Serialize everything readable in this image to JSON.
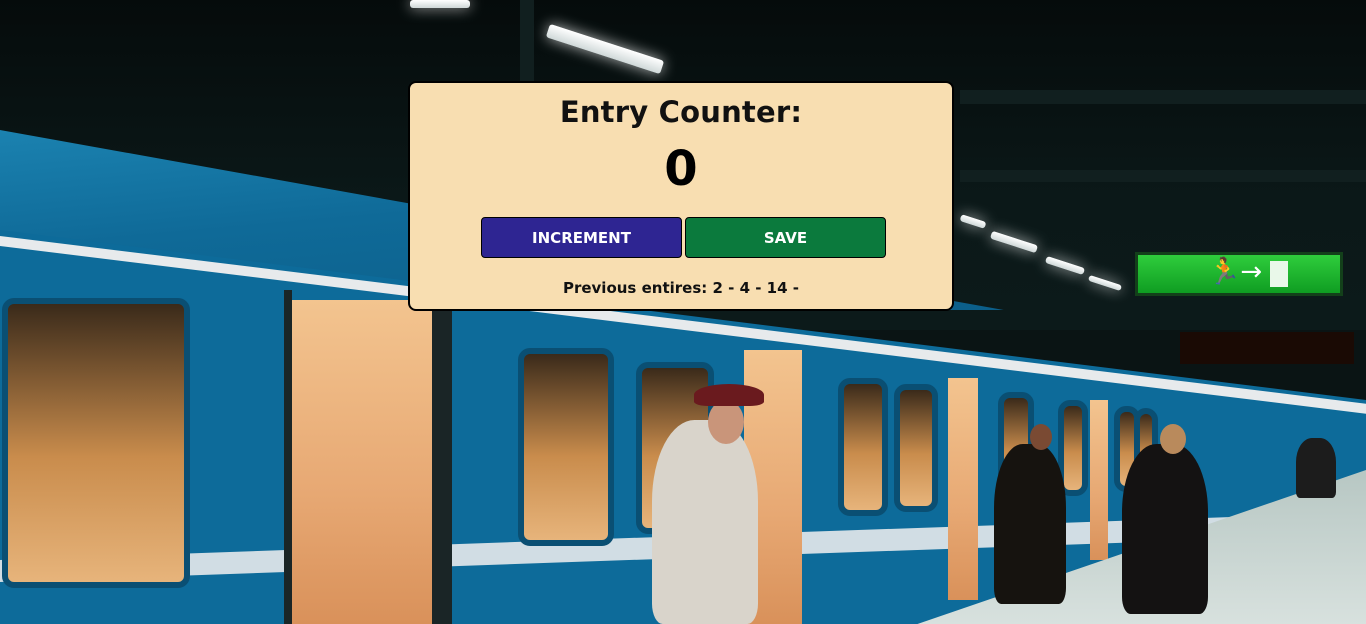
{
  "counter": {
    "title": "Entry Counter:",
    "value": "0",
    "increment_label": "INCREMENT",
    "save_label": "SAVE",
    "previous_entries_text": "Previous entires: 2 - 4 - 14 -",
    "previous_entries": [
      2,
      4,
      14
    ]
  },
  "background": {
    "description_icon": "subway-platform-photo",
    "exit_sign_icon": "running-man-exit-icon"
  },
  "colors": {
    "card_bg": "#f8deb1",
    "increment_bg": "#2e2592",
    "save_bg": "#0b7a3d"
  }
}
